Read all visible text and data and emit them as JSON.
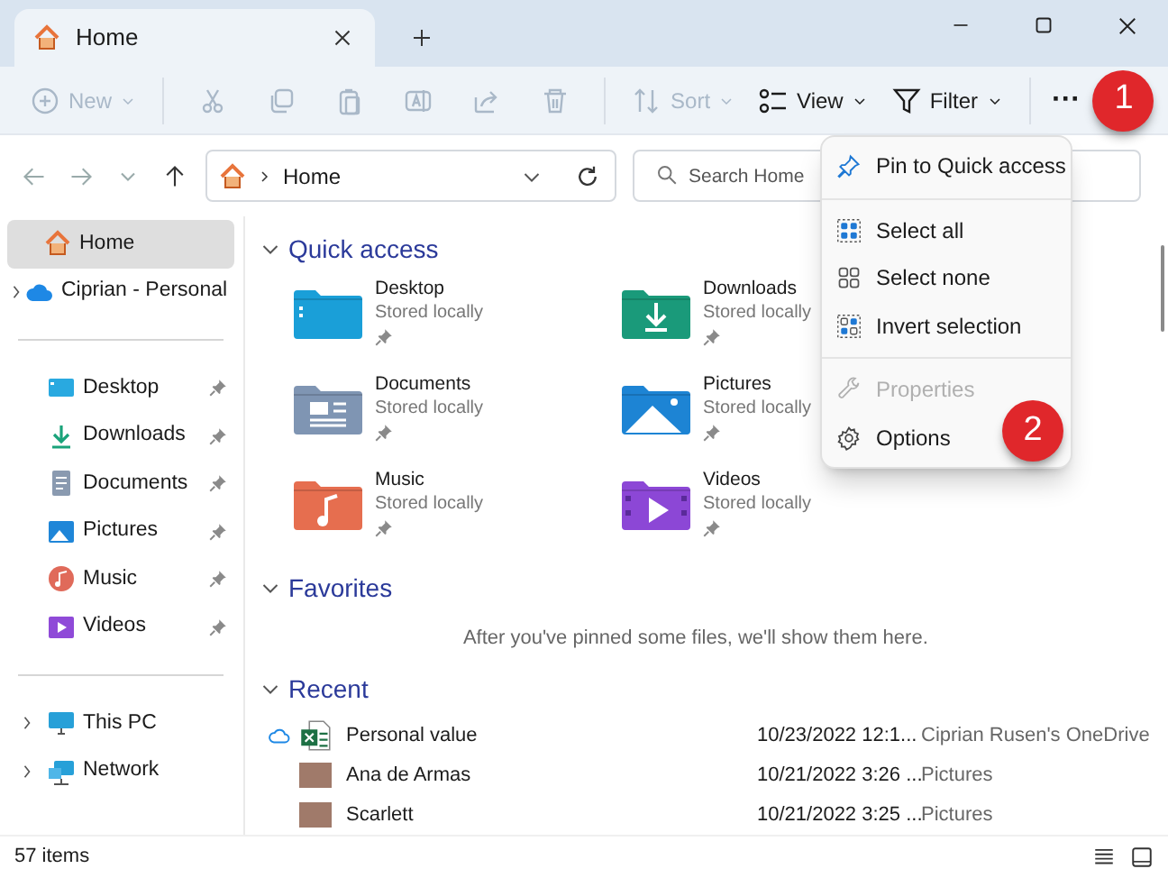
{
  "tabs": [
    {
      "label": "Home",
      "selected": true
    }
  ],
  "toolbar": {
    "items": [
      {
        "kind": "new",
        "label": "New",
        "disabled": true
      },
      {
        "kind": "cut",
        "disabled": true
      },
      {
        "kind": "copy",
        "disabled": true
      },
      {
        "kind": "paste",
        "disabled": true
      },
      {
        "kind": "rename",
        "disabled": true
      },
      {
        "kind": "share",
        "disabled": true
      },
      {
        "kind": "delete",
        "disabled": true
      },
      {
        "kind": "sort",
        "label": "Sort",
        "disabled": true
      },
      {
        "kind": "view",
        "label": "View",
        "disabled": false
      },
      {
        "kind": "filter",
        "label": "Filter",
        "disabled": false
      },
      {
        "kind": "more",
        "label": "···",
        "disabled": false,
        "badge": "1"
      }
    ]
  },
  "address": {
    "path": "Home",
    "search_placeholder": "Search Home"
  },
  "sidebar": {
    "sections": [
      [
        {
          "kind": "home",
          "label": "Home",
          "selected": true,
          "expandable": false,
          "pinned": false
        },
        {
          "kind": "cloud",
          "label": "Ciprian - Personal",
          "selected": false,
          "expandable": true,
          "pinned": false
        }
      ],
      [
        {
          "kind": "desktop",
          "label": "Desktop",
          "selected": false,
          "expandable": false,
          "pinned": true
        },
        {
          "kind": "downloads",
          "label": "Downloads",
          "selected": false,
          "expandable": false,
          "pinned": true
        },
        {
          "kind": "documents",
          "label": "Documents",
          "selected": false,
          "expandable": false,
          "pinned": true
        },
        {
          "kind": "pictures",
          "label": "Pictures",
          "selected": false,
          "expandable": false,
          "pinned": true
        },
        {
          "kind": "music",
          "label": "Music",
          "selected": false,
          "expandable": false,
          "pinned": true
        },
        {
          "kind": "videos",
          "label": "Videos",
          "selected": false,
          "expandable": false,
          "pinned": true
        }
      ],
      [
        {
          "kind": "pc",
          "label": "This PC",
          "selected": false,
          "expandable": true,
          "pinned": false
        },
        {
          "kind": "network",
          "label": "Network",
          "selected": false,
          "expandable": true,
          "pinned": false
        }
      ]
    ]
  },
  "quick_access": {
    "title": "Quick access",
    "expanded": true,
    "items": [
      {
        "kind": "desktop",
        "name": "Desktop",
        "status": "Stored locally",
        "pinned": true
      },
      {
        "kind": "downloads",
        "name": "Downloads",
        "status": "Stored locally",
        "pinned": true
      },
      {
        "kind": "documents",
        "name": "Documents",
        "status": "Stored locally",
        "pinned": true
      },
      {
        "kind": "pictures",
        "name": "Pictures",
        "status": "Stored locally",
        "pinned": true
      },
      {
        "kind": "music",
        "name": "Music",
        "status": "Stored locally",
        "pinned": true
      },
      {
        "kind": "videos",
        "name": "Videos",
        "status": "Stored locally",
        "pinned": true
      }
    ]
  },
  "favorites": {
    "title": "Favorites",
    "expanded": true,
    "message": "After you've pinned some files, we'll show them here."
  },
  "recent": {
    "title": "Recent",
    "expanded": true,
    "rows": [
      {
        "kind": "excel",
        "name": "Personal value",
        "date": "10/23/2022 12:1...",
        "location": "Ciprian Rusen's OneDrive",
        "cloud": true
      },
      {
        "kind": "photo",
        "name": "Ana de Armas",
        "date": "10/21/2022 3:26 ...",
        "location": "Pictures",
        "cloud": false
      },
      {
        "kind": "photo",
        "name": "Scarlett",
        "date": "10/21/2022 3:25 ...",
        "location": "Pictures",
        "cloud": false
      }
    ]
  },
  "menu": {
    "groups": [
      [
        {
          "kind": "pin",
          "label": "Pin to Quick access",
          "disabled": false
        }
      ],
      [
        {
          "kind": "selectall",
          "label": "Select all",
          "disabled": false
        },
        {
          "kind": "selectnone",
          "label": "Select none",
          "disabled": false
        },
        {
          "kind": "invert",
          "label": "Invert selection",
          "disabled": false
        }
      ],
      [
        {
          "kind": "properties",
          "label": "Properties",
          "disabled": true
        },
        {
          "kind": "options",
          "label": "Options",
          "disabled": false,
          "badge": "2"
        }
      ]
    ]
  },
  "status_bar": {
    "count": "57 items"
  }
}
